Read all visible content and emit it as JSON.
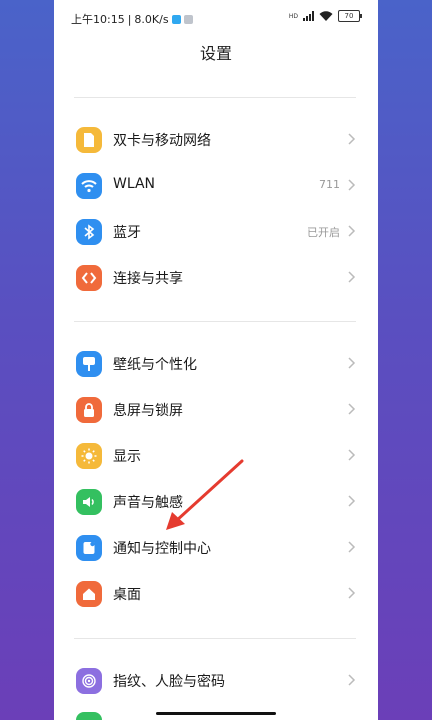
{
  "status_bar": {
    "time": "上午10:15",
    "separator": "|",
    "speed": "8.0K/s",
    "network_type": "HD",
    "battery": "70"
  },
  "header": {
    "title": "设置"
  },
  "settings": [
    {
      "label": "双卡与移动网络",
      "value": "",
      "icon": "sim-card-icon",
      "color": "#f5b93a"
    },
    {
      "label": "WLAN",
      "value": "711",
      "icon": "wifi-icon",
      "color": "#2f8ff0"
    },
    {
      "label": "蓝牙",
      "value": "已开启",
      "icon": "bluetooth-icon",
      "color": "#2f8ff0"
    },
    {
      "label": "连接与共享",
      "value": "",
      "icon": "connection-share-icon",
      "color": "#f06a3b"
    },
    {
      "label": "壁纸与个性化",
      "value": "",
      "icon": "wallpaper-icon",
      "color": "#2f8ff0"
    },
    {
      "label": "息屏与锁屏",
      "value": "",
      "icon": "lock-icon",
      "color": "#f06a3b"
    },
    {
      "label": "显示",
      "value": "",
      "icon": "sun-icon",
      "color": "#f5b93a"
    },
    {
      "label": "声音与触感",
      "value": "",
      "icon": "speaker-icon",
      "color": "#34c060"
    },
    {
      "label": "通知与控制中心",
      "value": "",
      "icon": "notification-icon",
      "color": "#2f8ff0"
    },
    {
      "label": "桌面",
      "value": "",
      "icon": "home-icon",
      "color": "#f06a3b"
    },
    {
      "label": "指纹、人脸与密码",
      "value": "",
      "icon": "fingerprint-icon",
      "color": "#8c6fe0"
    }
  ]
}
